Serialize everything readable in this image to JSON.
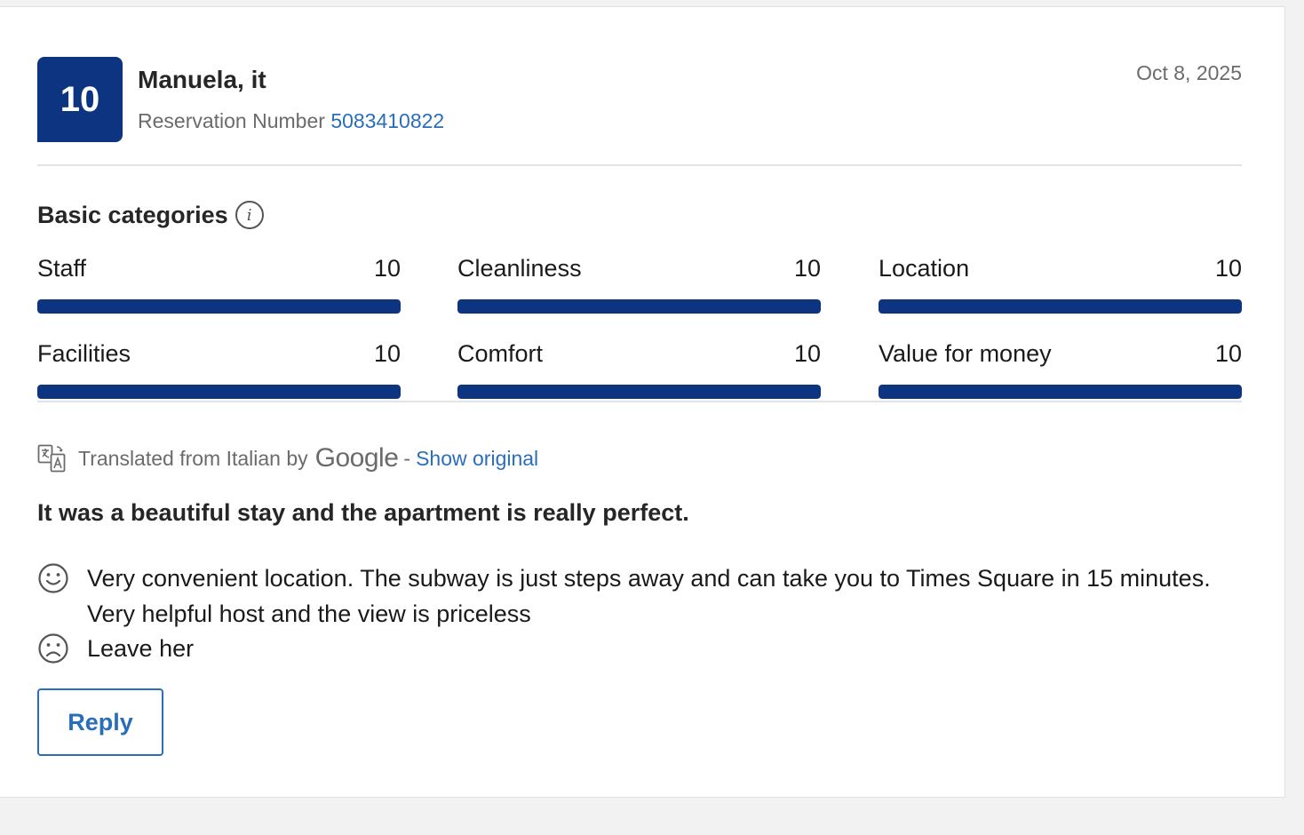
{
  "review": {
    "score": "10",
    "guest_name": "Manuela, it",
    "reservation_label": "Reservation Number",
    "reservation_number": "5083410822",
    "date": "Oct 8, 2025"
  },
  "categories": {
    "title": "Basic categories",
    "max_score": 10,
    "items": [
      {
        "label": "Staff",
        "score": "10",
        "fill_fraction": 1.0
      },
      {
        "label": "Cleanliness",
        "score": "10",
        "fill_fraction": 1.0
      },
      {
        "label": "Location",
        "score": "10",
        "fill_fraction": 1.0
      },
      {
        "label": "Facilities",
        "score": "10",
        "fill_fraction": 1.0
      },
      {
        "label": "Comfort",
        "score": "10",
        "fill_fraction": 1.0
      },
      {
        "label": "Value for money",
        "score": "10",
        "fill_fraction": 1.0
      }
    ]
  },
  "translation": {
    "text": "Translated from Italian by",
    "provider": "Google",
    "separator": "-",
    "show_original_label": "Show original"
  },
  "content": {
    "title": "It was a beautiful stay and the apartment is really perfect.",
    "positive": "Very convenient location. The subway is just steps away and can take you to Times Square in 15 minutes. Very helpful host and the view is priceless",
    "negative": "Leave her"
  },
  "actions": {
    "reply_label": "Reply"
  },
  "colors": {
    "brand": "#0c3480",
    "link": "#2a6ebb",
    "muted_text": "#6b6b6b"
  },
  "icons": {
    "info": "info-icon",
    "translate": "translate-icon",
    "positive": "smiley-face-icon",
    "negative": "sad-face-icon"
  }
}
